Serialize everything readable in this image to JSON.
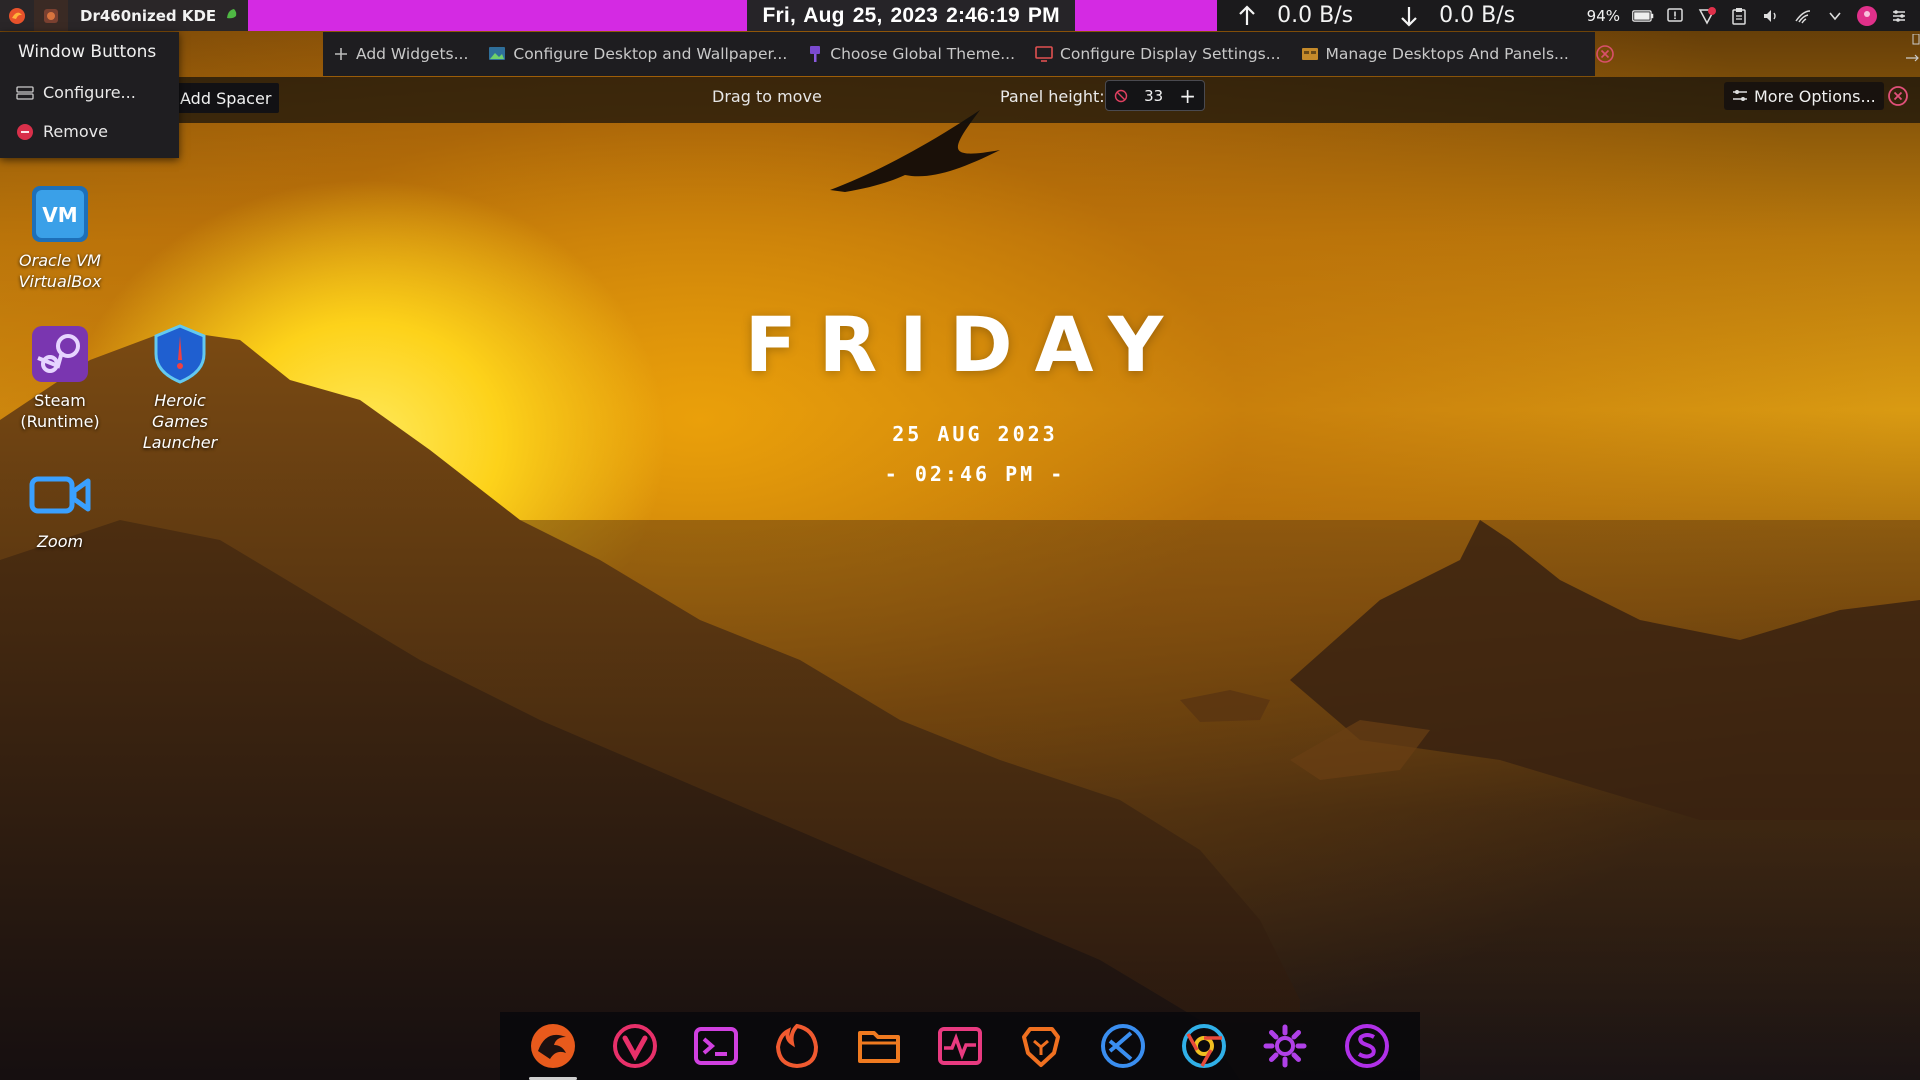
{
  "top_panel": {
    "title": "Dr460nized KDE",
    "clock": "Fri, Aug 25, 2023  2:46:19 PM",
    "upload_speed": "0.0 B/s",
    "download_speed": "0.0 B/s",
    "battery_percent": "94%",
    "tray_icons": [
      "notification-icon",
      "vpn-icon",
      "clipboard-icon",
      "volume-icon",
      "wifi-icon",
      "expand-tray-icon",
      "user-avatar-icon",
      "panel-settings-icon"
    ],
    "colors": {
      "accent": "#d42ae3",
      "panel": "#161618"
    }
  },
  "desktop_toolbar": {
    "items": [
      {
        "label": "Add Widgets...",
        "icon": "plus-icon"
      },
      {
        "label": "Configure Desktop and Wallpaper...",
        "icon": "wallpaper-icon"
      },
      {
        "label": "Choose Global Theme...",
        "icon": "theme-icon"
      },
      {
        "label": "Configure Display Settings...",
        "icon": "display-icon"
      },
      {
        "label": "Manage Desktops And Panels...",
        "icon": "desktops-icon"
      }
    ]
  },
  "panel_edit": {
    "add_spacer": "Add Spacer",
    "drag_to_move": "Drag to move",
    "panel_height_label": "Panel height:",
    "panel_height_value": "33",
    "more_options": "More Options..."
  },
  "context_menu": {
    "title": "Window Buttons",
    "items": [
      {
        "label": "Configure...",
        "icon": "configure-icon"
      },
      {
        "label": "Remove",
        "icon": "remove-icon"
      }
    ]
  },
  "desktop_icons": [
    {
      "label": "Oracle VM VirtualBox",
      "icon": "virtualbox-icon"
    },
    {
      "label": "Steam (Runtime)",
      "icon": "steam-icon"
    },
    {
      "label": "Heroic Games Launcher",
      "icon": "heroic-icon"
    },
    {
      "label": "Zoom",
      "icon": "zoom-icon"
    }
  ],
  "clock_widget": {
    "day": "FRIDAY",
    "date": "25 AUG 2023",
    "time": "- 02:46 PM -"
  },
  "dock": {
    "apps": [
      "garuda-icon",
      "vivaldi-icon",
      "terminal-icon",
      "firefox-icon",
      "file-manager-icon",
      "system-monitor-icon",
      "brave-icon",
      "vscodium-icon",
      "chromium-icon",
      "settings-icon",
      "stacer-icon"
    ]
  }
}
